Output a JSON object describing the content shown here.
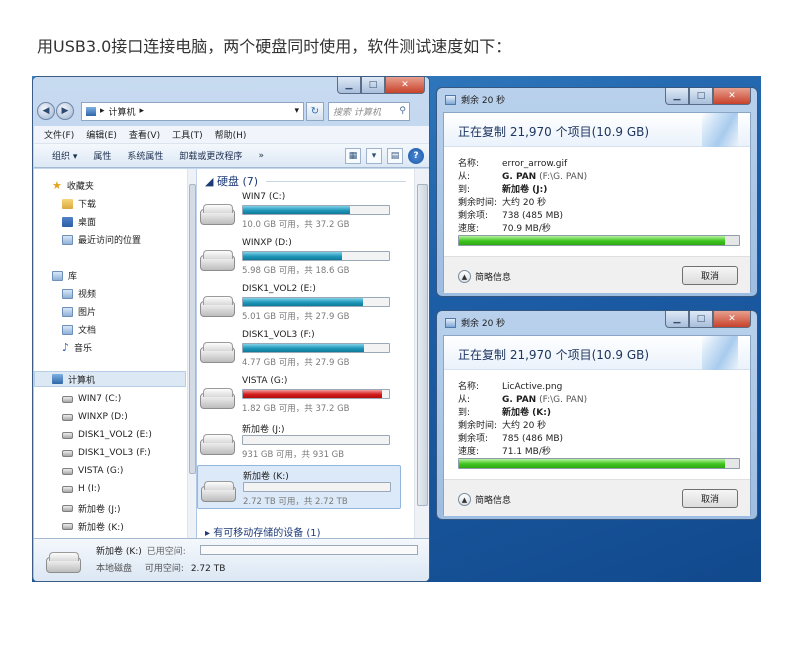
{
  "caption": "用USB3.0接口连接电脑，两个硬盘同时使用，软件测试速度如下：",
  "explorer": {
    "path": "计算机",
    "search_placeholder": "搜索 计算机",
    "menu": [
      "文件(F)",
      "编辑(E)",
      "查看(V)",
      "工具(T)",
      "帮助(H)"
    ],
    "commands": [
      "组织 ▾",
      "属性",
      "系统属性",
      "卸载或更改程序",
      "»"
    ],
    "nav": {
      "favorites": "收藏夹",
      "fav_items": [
        "下载",
        "桌面",
        "最近访问的位置"
      ],
      "libraries": "库",
      "lib_items": [
        "视频",
        "图片",
        "文档",
        "音乐"
      ],
      "computer": "计算机",
      "drives": [
        "WIN7 (C:)",
        "WINXP (D:)",
        "DISK1_VOL2 (E:)",
        "DISK1_VOL3 (F:)",
        "VISTA (G:)",
        "H (I:)",
        "新加卷 (J:)",
        "新加卷 (K:)"
      ]
    },
    "group_title": "◢ 硬盘 (7)",
    "group_more": "▸ 有可移动存储的设备 (1)",
    "drives": [
      {
        "name": "WIN7 (C:)",
        "free": "10.0 GB 可用，共 37.2 GB",
        "used_pct": 73,
        "warn": false
      },
      {
        "name": "WINXP (D:)",
        "free": "5.98 GB 可用，共 18.6 GB",
        "used_pct": 68,
        "warn": false
      },
      {
        "name": "DISK1_VOL2 (E:)",
        "free": "5.01 GB 可用，共 27.9 GB",
        "used_pct": 82,
        "warn": false
      },
      {
        "name": "DISK1_VOL3 (F:)",
        "free": "4.77 GB 可用，共 27.9 GB",
        "used_pct": 83,
        "warn": false
      },
      {
        "name": "VISTA (G:)",
        "free": "1.82 GB 可用，共 37.2 GB",
        "used_pct": 95,
        "warn": true
      },
      {
        "name": "新加卷 (J:)",
        "free": "931 GB 可用，共 931 GB",
        "used_pct": 0,
        "warn": false
      },
      {
        "name": "新加卷 (K:)",
        "free": "2.72 TB 可用，共 2.72 TB",
        "used_pct": 0,
        "warn": false
      }
    ],
    "details": {
      "name": "新加卷 (K:)",
      "used_label": "已用空间:",
      "type": "本地磁盘",
      "free_label": "可用空间:",
      "free_value": "2.72 TB"
    }
  },
  "dialogs": [
    {
      "title": "剩余 20 秒",
      "heading": "正在复制 21,970 个项目(10.9 GB)",
      "rows": [
        {
          "k": "名称:",
          "v": "error_arrow.gif"
        },
        {
          "k": "从:",
          "v": "G. PAN",
          "extra": " (F:\\G. PAN)"
        },
        {
          "k": "到:",
          "v": "新加卷 (J:)"
        },
        {
          "k": "剩余时间:",
          "v": "大约 20 秒"
        },
        {
          "k": "剩余项:",
          "v": "738 (485 MB)"
        },
        {
          "k": "速度:",
          "v": "70.9 MB/秒"
        }
      ],
      "progress": 0.95,
      "more": "简略信息",
      "cancel": "取消"
    },
    {
      "title": "剩余 20 秒",
      "heading": "正在复制 21,970 个项目(10.9 GB)",
      "rows": [
        {
          "k": "名称:",
          "v": "LicActive.png"
        },
        {
          "k": "从:",
          "v": "G. PAN",
          "extra": " (F:\\G. PAN)"
        },
        {
          "k": "到:",
          "v": "新加卷 (K:)"
        },
        {
          "k": "剩余时间:",
          "v": "大约 20 秒"
        },
        {
          "k": "剩余项:",
          "v": "785 (486 MB)"
        },
        {
          "k": "速度:",
          "v": "71.1 MB/秒"
        }
      ],
      "progress": 0.95,
      "more": "简略信息",
      "cancel": "取消"
    }
  ],
  "colors": {
    "desktop": "#1d5fa8",
    "drive_bar": "#1e97b8",
    "drive_bar_warn": "#d41c1c",
    "progress": "#3ec41f"
  }
}
